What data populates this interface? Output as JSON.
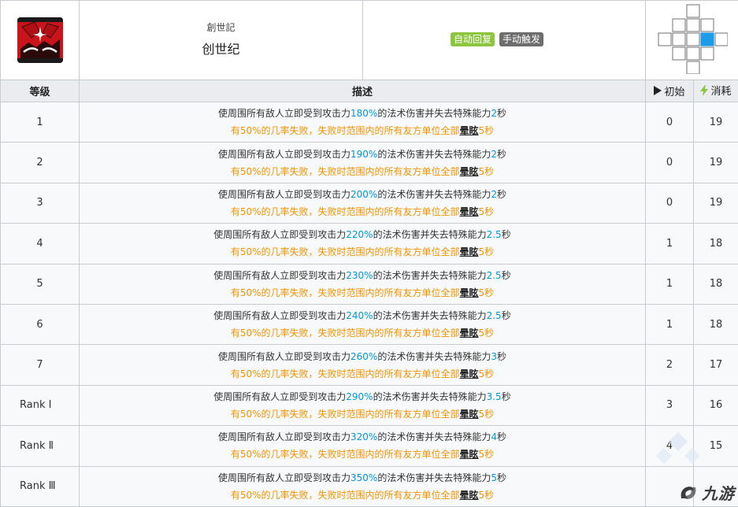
{
  "skill": {
    "name_jp": "創世記",
    "name_cn": "创世纪",
    "tags": [
      "自动回复",
      "手动触发"
    ]
  },
  "columns": {
    "level": "等级",
    "desc": "描述",
    "initial": "初始",
    "cost": "消耗"
  },
  "desc_template": {
    "l1_a": "使周围所有敌人立即受到攻击力",
    "l1_b": "的法术伤害并失去特殊能力",
    "l1_c": "秒",
    "l2_a": "有50%的几率失败，失败时范围内的所有友方单位全部",
    "l2_stun": "晕眩",
    "l2_b": "5秒"
  },
  "levels": [
    {
      "level": "1",
      "pct": "180%",
      "dur": "2",
      "initial": "0",
      "cost": "19"
    },
    {
      "level": "2",
      "pct": "190%",
      "dur": "2",
      "initial": "0",
      "cost": "19"
    },
    {
      "level": "3",
      "pct": "200%",
      "dur": "2",
      "initial": "0",
      "cost": "19"
    },
    {
      "level": "4",
      "pct": "220%",
      "dur": "2.5",
      "initial": "1",
      "cost": "18"
    },
    {
      "level": "5",
      "pct": "230%",
      "dur": "2.5",
      "initial": "1",
      "cost": "18"
    },
    {
      "level": "6",
      "pct": "240%",
      "dur": "2.5",
      "initial": "1",
      "cost": "18"
    },
    {
      "level": "7",
      "pct": "260%",
      "dur": "3",
      "initial": "2",
      "cost": "17"
    },
    {
      "level": "Rank Ⅰ",
      "pct": "290%",
      "dur": "3.5",
      "initial": "3",
      "cost": "16"
    },
    {
      "level": "Rank Ⅱ",
      "pct": "320%",
      "dur": "4",
      "initial": "4",
      "cost": "15"
    },
    {
      "level": "Rank Ⅲ",
      "pct": "350%",
      "dur": "5",
      "initial": "",
      "cost": ""
    }
  ],
  "watermark": {
    "text": "九游",
    "icon": "jiuyou-logo-icon"
  },
  "colors": {
    "accent_blue": "#0098dc",
    "warning_orange": "#f29300",
    "tag_green": "#8cc63f",
    "tag_gray": "#6d6d6d",
    "range_highlight": "#1e9be9",
    "lightning_green": "#8cc63f"
  },
  "range_grid": {
    "cells": [
      [
        0,
        2
      ],
      [
        1,
        1
      ],
      [
        1,
        2
      ],
      [
        1,
        3
      ],
      [
        2,
        0
      ],
      [
        2,
        1
      ],
      [
        2,
        2
      ],
      [
        2,
        3
      ],
      [
        2,
        4
      ],
      [
        3,
        1
      ],
      [
        3,
        2
      ],
      [
        3,
        3
      ],
      [
        4,
        2
      ]
    ],
    "highlight": [
      2,
      3
    ]
  }
}
